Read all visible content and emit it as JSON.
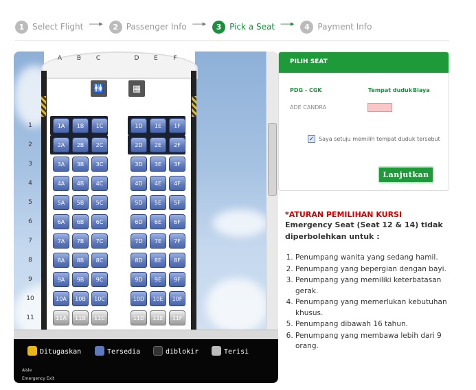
{
  "steps": [
    {
      "num": "1",
      "label": "Select Flight",
      "active": false
    },
    {
      "num": "2",
      "label": "Passenger Info",
      "active": false
    },
    {
      "num": "3",
      "label": "Pick a Seat",
      "active": true
    },
    {
      "num": "4",
      "label": "Payment Info",
      "active": false
    }
  ],
  "arrow": "-----▸",
  "cabin": {
    "columns": [
      "A",
      "B",
      "C",
      "D",
      "E",
      "F"
    ],
    "rows": [
      "1",
      "2",
      "3",
      "4",
      "5",
      "6",
      "7",
      "8",
      "9",
      "10",
      "11"
    ],
    "occupied_row": "11"
  },
  "legend": {
    "assigned": "Ditugaskan",
    "available": "Tersedia",
    "blocked": "diblokir",
    "taken": "Terisi",
    "aisle": "Aisle",
    "exit": "Emergency Exit",
    "colors": {
      "assigned": "#e7b61b",
      "available": "#5e79bd",
      "blocked": "#333333",
      "taken": "#bbbbbb"
    }
  },
  "panel": {
    "title": "PILIH SEAT",
    "route": "PDG - CGK",
    "seat_header": "Tempat duduk",
    "cost_header": "Biaya",
    "passenger": "ADE CANDRA",
    "agree": "Saya setuju memilih tempat duduk tersebut",
    "button": "Lanjutkan"
  },
  "rules": {
    "title": "*ATURAN PEMILIHAN KURSI",
    "subtitle": "Emergency Seat (Seat 12 & 14) tidak diperbolehkan untuk :",
    "items": [
      "Penumpang wanita yang sedang hamil.",
      "Penumpang yang bepergian dengan bayi.",
      "Penumpang yang memiliki keterbatasan gerak.",
      "Penumpang yang memerlukan kebutuhan khusus.",
      "Penumpang dibawah 16 tahun.",
      "Penumpang yang membawa lebih dari 9 orang."
    ]
  }
}
